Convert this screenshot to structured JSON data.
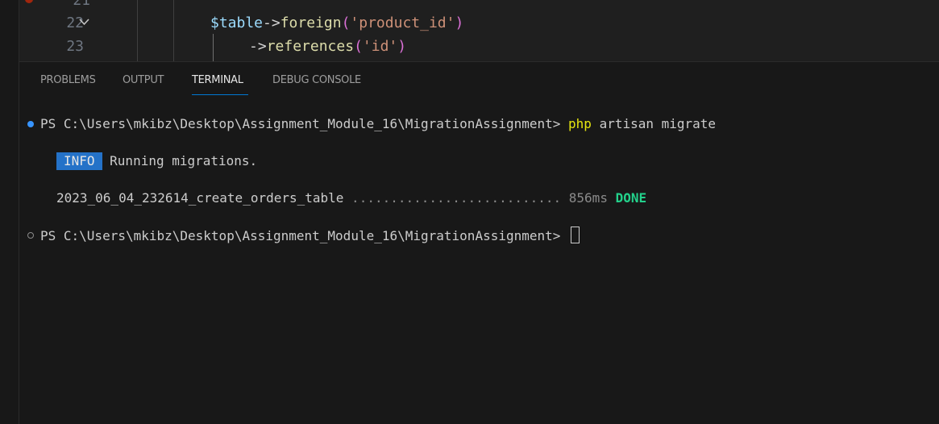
{
  "editor": {
    "lines": [
      {
        "number": "21"
      },
      {
        "number": "22"
      },
      {
        "number": "23"
      }
    ],
    "line22": {
      "var": "$table",
      "arrow": "->",
      "fn": "foreign",
      "open": "(",
      "str": "'product_id'",
      "close": ")"
    },
    "line23": {
      "arrow": "->",
      "fn": "references",
      "open": "(",
      "str": "'id'",
      "close": ")"
    }
  },
  "panel": {
    "tabs": [
      {
        "label": "PROBLEMS"
      },
      {
        "label": "OUTPUT"
      },
      {
        "label": "TERMINAL"
      },
      {
        "label": "DEBUG CONSOLE"
      }
    ],
    "active_tab": "TERMINAL"
  },
  "terminal": {
    "prompt1": "PS C:\\Users\\mkibz\\Desktop\\Assignment_Module_16\\MigrationAssignment> ",
    "cmd_php": "php",
    "cmd_rest": " artisan migrate",
    "info_badge": "INFO",
    "info_text": " Running migrations.",
    "migration_name": "2023_06_04_232614_create_orders_table",
    "migration_dots": " ........................... ",
    "migration_time": "856ms",
    "migration_status": "DONE",
    "prompt2": "PS C:\\Users\\mkibz\\Desktop\\Assignment_Module_16\\MigrationAssignment> "
  },
  "colors": {
    "accent": "#0078d4",
    "info_badge_bg": "#2472c8",
    "done": "#23d18b",
    "php_keyword": "#e5e510",
    "status_dot": "#3794ff"
  }
}
